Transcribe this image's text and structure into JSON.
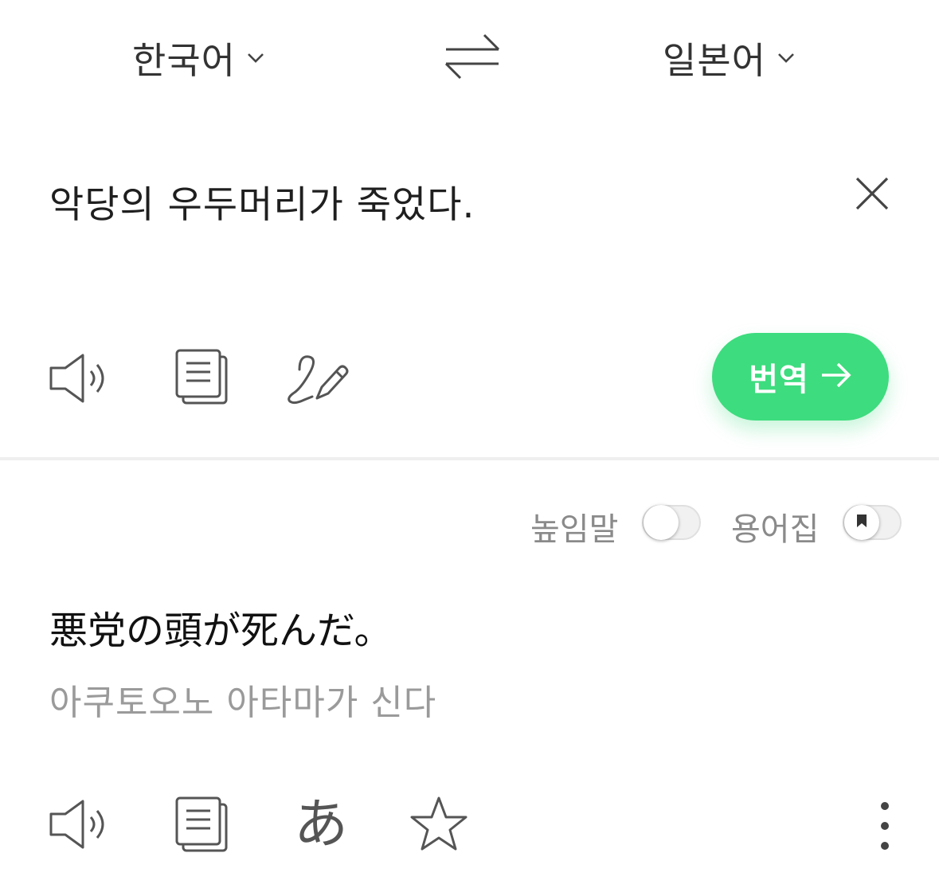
{
  "header": {
    "source_language": "한국어",
    "target_language": "일본어",
    "swap_icon": "swap-arrows-icon"
  },
  "input": {
    "text": "악당의 우두머리가 죽었다.",
    "clear_icon": "close-icon",
    "tools": [
      "speaker-icon",
      "copy-icon",
      "handwriting-icon"
    ]
  },
  "translate_button": {
    "label": "번역",
    "color": "#3ddc7e"
  },
  "options": {
    "honorific_label": "높임말",
    "honorific_on": false,
    "glossary_label": "용어집",
    "glossary_on": false
  },
  "output": {
    "text": "悪党の頭が死んだ。",
    "pronunciation": "아쿠토오노 아타마가 신다",
    "kana_label": "あ",
    "tools": [
      "speaker-icon",
      "copy-icon",
      "kana-icon",
      "star-icon",
      "more-vertical-icon"
    ]
  }
}
